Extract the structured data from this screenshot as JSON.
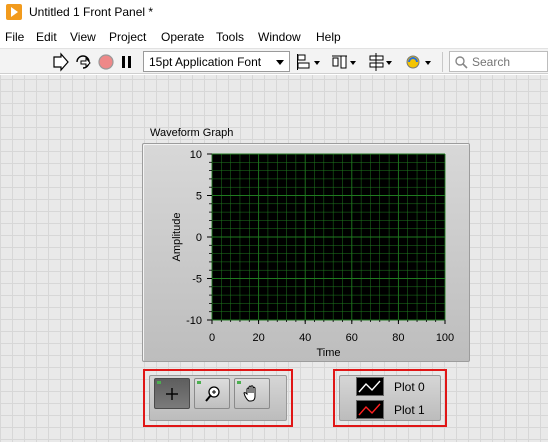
{
  "window": {
    "title": "Untitled 1 Front Panel *"
  },
  "menu": {
    "items": [
      "File",
      "Edit",
      "View",
      "Project",
      "Operate",
      "Tools",
      "Window",
      "Help"
    ]
  },
  "toolbar": {
    "font_select": "15pt Application Font",
    "search_placeholder": "Search",
    "icons": [
      "run-arrow-icon",
      "run-continuously-icon",
      "abort-icon",
      "pause-icon",
      "align-objects-icon",
      "distribute-objects-icon",
      "resize-objects-icon",
      "reorder-icon",
      "search-icon"
    ]
  },
  "graph": {
    "label": "Waveform Graph",
    "xlabel": "Time",
    "ylabel": "Amplitude",
    "x_ticks": [
      "0",
      "20",
      "40",
      "60",
      "80",
      "100"
    ],
    "y_ticks": [
      "10",
      "5",
      "0",
      "-5",
      "-10"
    ],
    "plot_background": "#000000",
    "grid_color": "#1f7a1f"
  },
  "chart_data": {
    "type": "line",
    "title": "Waveform Graph",
    "xlabel": "Time",
    "ylabel": "Amplitude",
    "xlim": [
      0,
      100
    ],
    "ylim": [
      -10,
      10
    ],
    "x_ticks": [
      0,
      20,
      40,
      60,
      80,
      100
    ],
    "y_ticks": [
      10,
      5,
      0,
      -5,
      -10
    ],
    "grid": true,
    "series": []
  },
  "graph_palette": {
    "tools": [
      {
        "name": "cursor-movement-tool",
        "icon": "crosshair-icon",
        "active": true
      },
      {
        "name": "zoom-tool",
        "icon": "zoom-icon",
        "active": false
      },
      {
        "name": "panning-tool",
        "icon": "hand-icon",
        "active": false
      }
    ]
  },
  "plot_legend": {
    "items": [
      {
        "label": "Plot 0",
        "color": "#ffffff"
      },
      {
        "label": "Plot 1",
        "color": "#ff2020"
      }
    ]
  },
  "highlight_color": "#e01616"
}
